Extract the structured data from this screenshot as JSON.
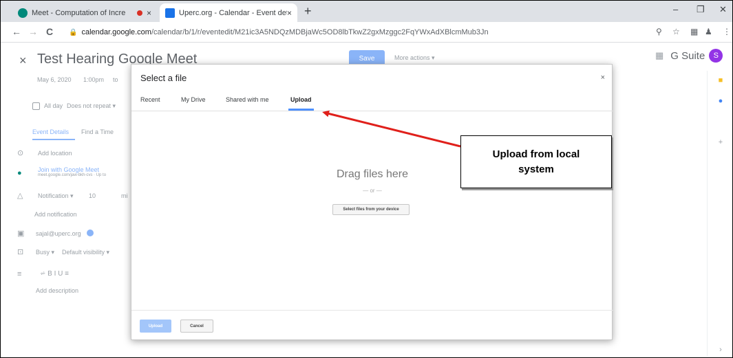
{
  "browser": {
    "tabs": [
      {
        "title": "Meet - Computation of Incre",
        "close": "×"
      },
      {
        "title": "Uperc.org - Calendar - Event det",
        "close": "×"
      }
    ],
    "new_tab": "+",
    "window_controls": {
      "minimize": "–",
      "restore": "❐",
      "close": "✕"
    },
    "nav": {
      "back": "←",
      "forward": "→",
      "reload": "C"
    },
    "url": {
      "host": "calendar.google.com",
      "path": "/calendar/b/1/r/eventedit/M21ic3A5NDQzMDBjaWc5OD8lbTkwZ2gxMzggc2FqYWxAdXBlcmMub3Jn"
    }
  },
  "calendar": {
    "close": "×",
    "event_title": "Test Hearing Google Meet",
    "save_label": "Save",
    "more_actions": "More actions ▾",
    "gsuite_label": "G Suite",
    "avatar_letter": "S",
    "date": "May 6, 2020",
    "time": "1:00pm",
    "to": "to",
    "all_day": "All day",
    "repeat": "Does not repeat ▾",
    "tab_event_details": "Event Details",
    "tab_find_time": "Find a Time",
    "add_location": "Add location",
    "join_meet": "Join with Google Meet",
    "meet_link": "meet.google.com/jaw-bkh-cvs · Up to",
    "notification": "Notification ▾",
    "notification_value": "10",
    "notification_unit": "mi",
    "add_notification": "Add notification",
    "calendar_owner": "sajal@uperc.org",
    "busy": "Busy ▾",
    "visibility": "Default visibility ▾",
    "format_tools": "⩫   B   I   U   ≡",
    "add_description": "Add description"
  },
  "dialog": {
    "title": "Select a file",
    "close": "×",
    "tabs": [
      "Recent",
      "My Drive",
      "Shared with me",
      "Upload"
    ],
    "active_tab": "Upload",
    "drag_text": "Drag files here",
    "or_text": "— or —",
    "select_button": "Select files from your device",
    "upload_button": "Upload",
    "cancel_button": "Cancel"
  },
  "annotation": {
    "text_line1": "Upload from local",
    "text_line2": "system",
    "arrow_color": "#e0201b"
  },
  "colors": {
    "accent": "#4d90fe",
    "save_disabled": "#8ab4f8",
    "avatar": "#9334e6"
  }
}
